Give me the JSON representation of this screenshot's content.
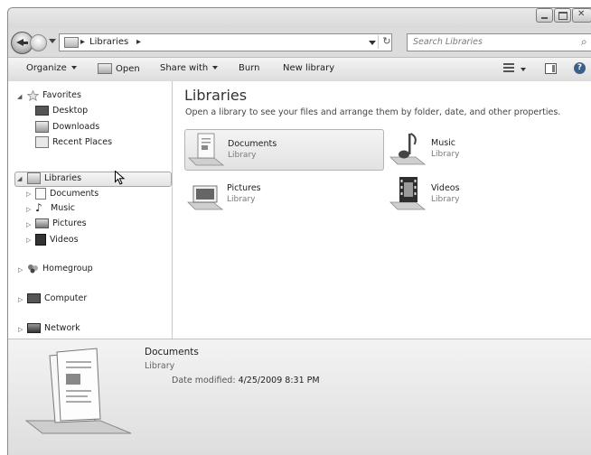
{
  "address": {
    "segments": [
      "Libraries"
    ]
  },
  "search": {
    "placeholder": "Search Libraries"
  },
  "toolbar": {
    "organize": "Organize",
    "open": "Open",
    "share_with": "Share with",
    "burn": "Burn",
    "new_library": "New library"
  },
  "nav": {
    "favorites": {
      "label": "Favorites",
      "items": [
        "Desktop",
        "Downloads",
        "Recent Places"
      ]
    },
    "libraries": {
      "label": "Libraries",
      "items": [
        "Documents",
        "Music",
        "Pictures",
        "Videos"
      ]
    },
    "homegroup": "Homegroup",
    "computer": "Computer",
    "network": "Network"
  },
  "content": {
    "title": "Libraries",
    "subtitle": "Open a library to see your files and arrange them by folder, date, and other properties.",
    "libraries": [
      {
        "name": "Documents",
        "type": "Library"
      },
      {
        "name": "Music",
        "type": "Library"
      },
      {
        "name": "Pictures",
        "type": "Library"
      },
      {
        "name": "Videos",
        "type": "Library"
      }
    ]
  },
  "details": {
    "name": "Documents",
    "type": "Library",
    "modified_label": "Date modified:",
    "modified_value": "4/25/2009 8:31 PM"
  }
}
